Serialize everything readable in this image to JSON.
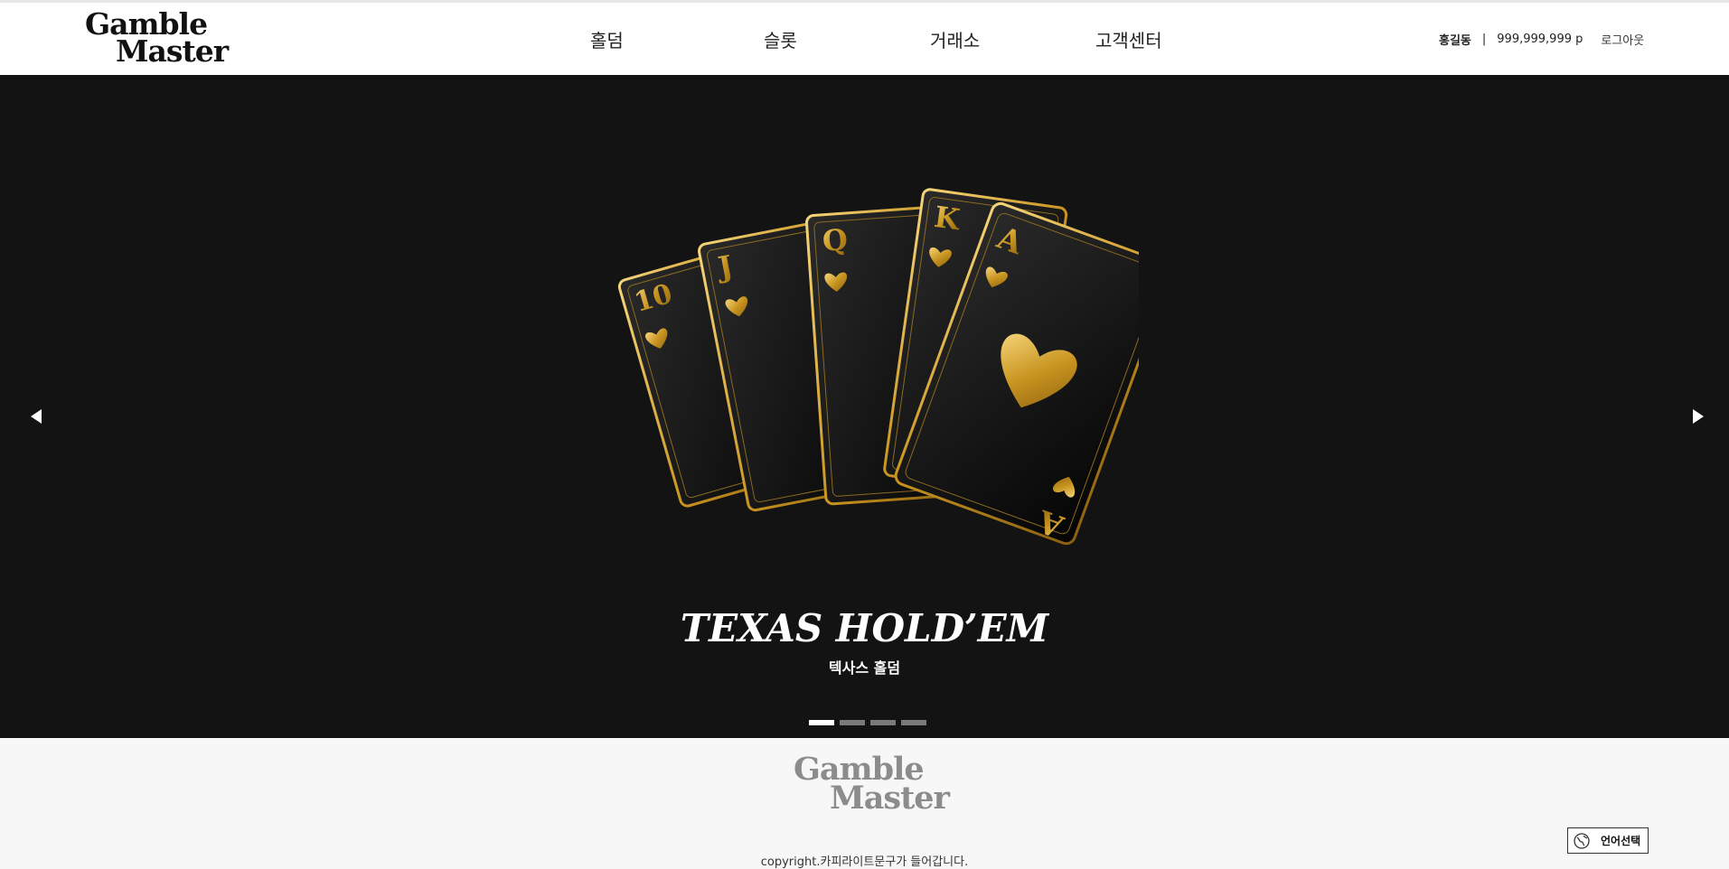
{
  "header": {
    "logo_line1": "Gamble",
    "logo_line2": "Master",
    "nav": [
      {
        "label": "홀덤"
      },
      {
        "label": "슬롯"
      },
      {
        "label": "거래소"
      },
      {
        "label": "고객센터"
      }
    ],
    "user": {
      "name": "홍길동",
      "separator": "|",
      "points": "999,999,999 p",
      "logout_label": "로그아웃"
    }
  },
  "hero": {
    "title": "TEXAS HOLD’EM",
    "subtitle": "텍사스 홀덤",
    "slides_count": 4,
    "active_slide": 1,
    "cards": [
      "10",
      "J",
      "Q",
      "K",
      "A"
    ],
    "colors": {
      "background": "#131313",
      "gold": "#d4a52e"
    }
  },
  "footer": {
    "logo_line1": "Gamble",
    "logo_line2": "Master",
    "copyright": "copyright.카피라이트문구가 들어갑니다.",
    "language_button": "언어선택"
  }
}
